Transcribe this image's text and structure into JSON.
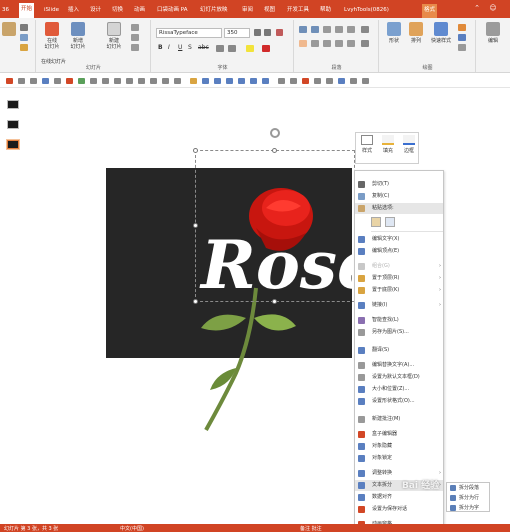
{
  "colors": {
    "accent": "#d14424",
    "format_tab": "#e88a4a",
    "slide_bg": "#262626",
    "rose_red": "#e8231c"
  },
  "tabs": [
    {
      "label": "36"
    },
    {
      "label": "开始"
    },
    {
      "label": "iSlide"
    },
    {
      "label": "插入"
    },
    {
      "label": "设计"
    },
    {
      "label": "切换"
    },
    {
      "label": "动画"
    },
    {
      "label": "口袋动画 PA"
    },
    {
      "label": "幻灯片放映"
    },
    {
      "label": "审阅"
    },
    {
      "label": "视图"
    },
    {
      "label": "开发工具"
    },
    {
      "label": "帮助"
    },
    {
      "label": "LvyhTools(0826)"
    },
    {
      "label": "格式"
    }
  ],
  "ribbon": {
    "clipboard": {
      "paste_btn": "粘贴"
    },
    "slides": {
      "from_beginning": "在线",
      "from_beginning2": "幻灯片",
      "new_slide": "新增",
      "new_slide2": "幻灯片",
      "new2": "新建",
      "new2b": "幻灯片",
      "new_slide3": "幻灯片",
      "reset": "在线幻灯片",
      "group_label": "幻灯片"
    },
    "font": {
      "font_name": "RissaTypeface",
      "font_size": "350",
      "group_label": "字体"
    },
    "paragraph": {
      "group_label": "段落"
    },
    "drawing": {
      "shape": "形状",
      "arrange": "排列",
      "quick_styles": "快速样式",
      "group_label": "绘图"
    },
    "editing": {
      "edit": "编辑"
    }
  },
  "slide": {
    "word": "Rose"
  },
  "mini_toolbar": {
    "style": "样式",
    "fill": "填充",
    "outline": "边框"
  },
  "context_menu": [
    {
      "label": "剪切(T)",
      "icon": "scissors-icon",
      "disabled": false
    },
    {
      "label": "复制(C)",
      "icon": "copy-icon",
      "disabled": false
    },
    {
      "label": "粘贴选项:",
      "icon": "paste-icon",
      "disabled": false
    },
    {
      "label": "编辑文字(X)",
      "icon": "edit-text-icon",
      "disabled": false
    },
    {
      "label": "编辑顶点(E)",
      "icon": "edit-points-icon",
      "disabled": false
    },
    {
      "label": "组合(G)",
      "icon": "group-icon",
      "disabled": true
    },
    {
      "label": "置于顶层(R)",
      "icon": "bring-front-icon",
      "disabled": false
    },
    {
      "label": "置于底层(K)",
      "icon": "send-back-icon",
      "disabled": false
    },
    {
      "label": "链接(I)",
      "icon": "link-icon",
      "disabled": false
    },
    {
      "label": "智能查找(L)",
      "icon": "smart-lookup-icon",
      "disabled": false
    },
    {
      "label": "另存为图片(S)...",
      "icon": "save-image-icon",
      "disabled": false
    },
    {
      "label": "翻译(S)",
      "icon": "translate-icon",
      "disabled": false
    },
    {
      "label": "编辑替换文字(A)...",
      "icon": "alt-text-icon",
      "disabled": false
    },
    {
      "label": "设置为默认文本框(D)",
      "icon": "default-textbox-icon",
      "disabled": false
    },
    {
      "label": "大小和位置(Z)...",
      "icon": "size-position-icon",
      "disabled": false
    },
    {
      "label": "设置形状格式(O)...",
      "icon": "format-shape-icon",
      "disabled": false
    },
    {
      "label": "新建批注(M)",
      "icon": "comment-icon",
      "disabled": false
    },
    {
      "label": "盒子编辑器",
      "icon": "box-editor-icon",
      "disabled": false
    },
    {
      "label": "对象隐藏",
      "icon": "hide-object-icon",
      "disabled": false
    },
    {
      "label": "对象锁定",
      "icon": "lock-object-icon",
      "disabled": false
    },
    {
      "label": "调整转换",
      "icon": "convert-icon",
      "disabled": false
    },
    {
      "label": "文本拆分",
      "icon": "split-text-icon",
      "disabled": false
    },
    {
      "label": "数据对齐",
      "icon": "align-data-icon",
      "disabled": false
    },
    {
      "label": "设置为保存对话",
      "icon": "save-dialog-icon",
      "disabled": false
    },
    {
      "label": "动画窗格",
      "icon": "animation-pane-icon",
      "disabled": false
    }
  ],
  "submenu": [
    {
      "label": "拆分段落"
    },
    {
      "label": "拆分为行"
    },
    {
      "label": "拆分为字"
    }
  ],
  "status": {
    "left": "幻灯片 第 3 张，共 3 张",
    "middle": "中文(中国)",
    "right": "备注  批注"
  },
  "watermark": "Bai 经验"
}
